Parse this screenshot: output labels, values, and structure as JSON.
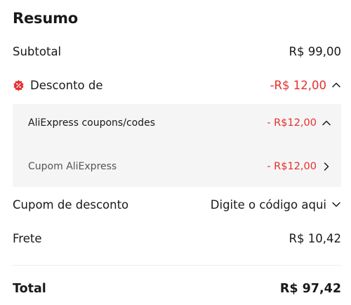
{
  "summary": {
    "title": "Resumo",
    "subtotal": {
      "label": "Subtotal",
      "value": "R$ 99,00"
    },
    "discount": {
      "label": "Desconto de",
      "value": "-R$ 12,00",
      "items": [
        {
          "label": "AliExpress coupons/codes",
          "value": "- R$12,00"
        },
        {
          "label": "Cupom AliExpress",
          "value": "- R$12,00"
        }
      ]
    },
    "coupon": {
      "label": "Cupom de desconto",
      "value": "Digite o código aqui"
    },
    "shipping": {
      "label": "Frete",
      "value": "R$ 10,42"
    },
    "total": {
      "label": "Total",
      "value": "R$ 97,42"
    }
  },
  "colors": {
    "accent_red": "#e62e2e",
    "panel_bg": "#f5f5f5",
    "text": "#191919"
  },
  "icons": {
    "discount": "discount-badge-icon",
    "collapse": "chevron-up-icon",
    "open": "chevron-right-icon",
    "expand": "chevron-down-icon"
  }
}
